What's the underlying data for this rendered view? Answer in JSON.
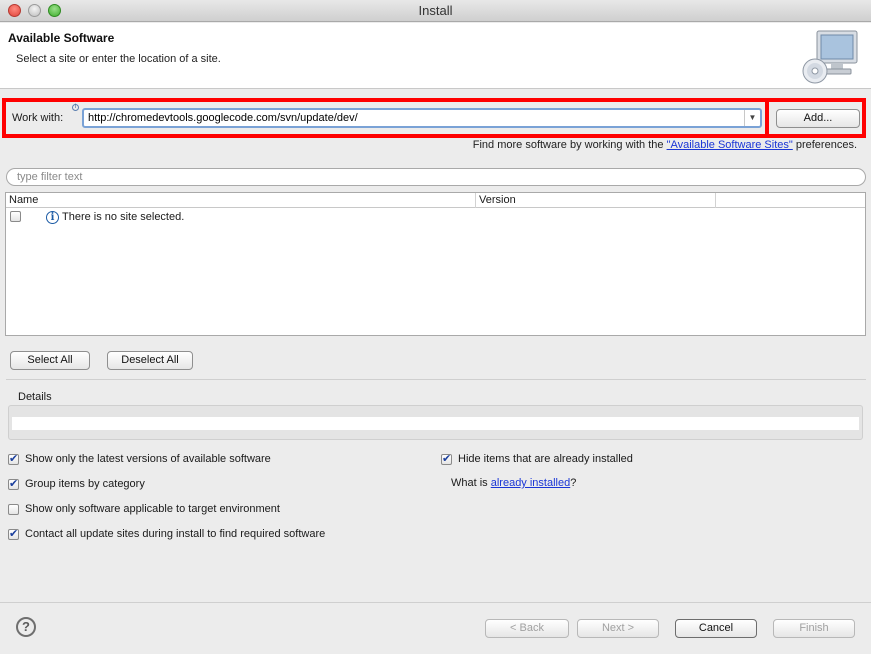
{
  "window": {
    "title": "Install"
  },
  "header": {
    "title": "Available Software",
    "subtitle": "Select a site or enter the location of a site.",
    "icon": "computer-cd-icon"
  },
  "work_with": {
    "label": "Work with:",
    "value": "http://chromedevtools.googlecode.com/svn/update/dev/",
    "add_button": "Add...",
    "find_more_prefix": "Find more software by working with the ",
    "find_more_link": "\"Available Software Sites\"",
    "find_more_suffix": " preferences."
  },
  "filter": {
    "placeholder": "type filter text"
  },
  "table": {
    "columns": [
      "Name",
      "Version"
    ],
    "rows": [
      {
        "checked": false,
        "text": "There is no site selected."
      }
    ]
  },
  "selection": {
    "select_all": "Select All",
    "deselect_all": "Deselect All"
  },
  "details": {
    "label": "Details"
  },
  "options": {
    "latest_versions": {
      "label": "Show only the latest versions of available software",
      "checked": true
    },
    "group_by_category": {
      "label": "Group items by category",
      "checked": true
    },
    "target_env": {
      "label": "Show only software applicable to target environment",
      "checked": false
    },
    "contact_sites": {
      "label": "Contact all update sites during install to find required software",
      "checked": true
    },
    "hide_installed": {
      "label": "Hide items that are already installed",
      "checked": true
    },
    "what_is_prefix": "What is ",
    "what_is_link": "already installed",
    "what_is_suffix": "?"
  },
  "footer": {
    "back": "< Back",
    "next": "Next >",
    "cancel": "Cancel",
    "finish": "Finish"
  }
}
